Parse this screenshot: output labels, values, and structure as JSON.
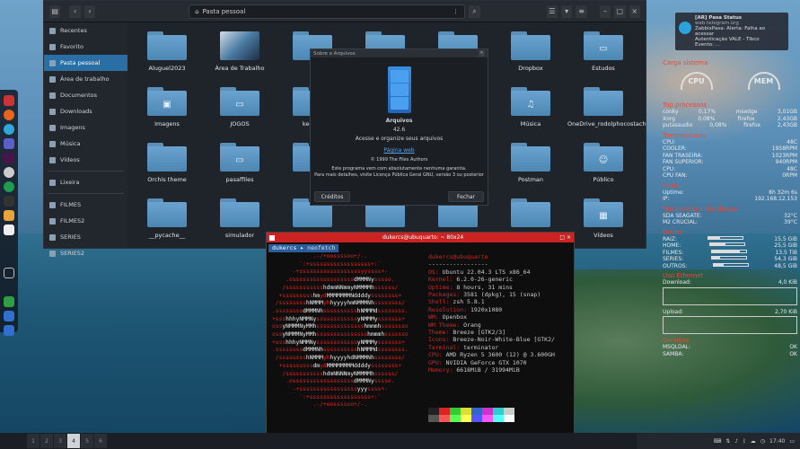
{
  "file_manager": {
    "path": "Pasta pessoal",
    "sidebar": [
      {
        "label": "Recentes",
        "active": false
      },
      {
        "label": "Favorito",
        "active": false
      },
      {
        "label": "Pasta pessoal",
        "active": true
      },
      {
        "label": "Área de trabalho",
        "active": false
      },
      {
        "label": "Documentos",
        "active": false
      },
      {
        "label": "Downloads",
        "active": false
      },
      {
        "label": "Imagens",
        "active": false
      },
      {
        "label": "Música",
        "active": false
      },
      {
        "label": "Vídeos",
        "active": false
      },
      {
        "label": "Lixeira",
        "active": false
      },
      {
        "label": "FILMES",
        "active": false
      },
      {
        "label": "FILMES2",
        "active": false
      },
      {
        "label": "SERIES",
        "active": false
      },
      {
        "label": "SERIES2",
        "active": false
      }
    ],
    "files": [
      {
        "name": "Aluguel2023",
        "kind": "folder"
      },
      {
        "name": "Área de Trabalho",
        "kind": "thumb"
      },
      {
        "name": "a",
        "kind": "folder"
      },
      {
        "name": "",
        "kind": "folder"
      },
      {
        "name": "",
        "kind": "folder"
      },
      {
        "name": "Dropbox",
        "kind": "folder"
      },
      {
        "name": "Estudos",
        "kind": "folder",
        "glyph": "▭"
      },
      {
        "name": "Imagens",
        "kind": "folder",
        "glyph": "▣"
      },
      {
        "name": "JOGOS",
        "kind": "folder",
        "glyph": "▭"
      },
      {
        "name": "keep-p",
        "kind": "folder"
      },
      {
        "name": "",
        "kind": "folder"
      },
      {
        "name": "",
        "kind": "folder"
      },
      {
        "name": "Música",
        "kind": "folder",
        "glyph": "♫"
      },
      {
        "name": "OneDrive_rodolphocostach",
        "kind": "folder"
      },
      {
        "name": "Orchis theme",
        "kind": "folder"
      },
      {
        "name": "pasaffiles",
        "kind": "folder",
        "glyph": "▭"
      },
      {
        "name": "",
        "kind": "folder"
      },
      {
        "name": "",
        "kind": "folder"
      },
      {
        "name": "",
        "kind": "folder"
      },
      {
        "name": "Postman",
        "kind": "folder"
      },
      {
        "name": "Público",
        "kind": "folder",
        "glyph": "☺"
      },
      {
        "name": "__pycache__",
        "kind": "folder"
      },
      {
        "name": "simulador",
        "kind": "folder"
      },
      {
        "name": "",
        "kind": "folder"
      },
      {
        "name": "",
        "kind": "folder"
      },
      {
        "name": "",
        "kind": "folder"
      },
      {
        "name": "",
        "kind": "folder"
      },
      {
        "name": "Vídeos",
        "kind": "folder",
        "glyph": "▦"
      }
    ]
  },
  "about": {
    "title": "Sobre o Arquivos",
    "app": "Arquivos",
    "version": "42.6",
    "desc": "Acesse e organize seus arquivos",
    "link": "Página web",
    "copyright": "© 1999 The Files Authors",
    "warranty": "Este programa vem com absolutamente nenhuma garantia.",
    "license": "Para mais detalhes, visite Licença Pública Geral GNU, versão 3 ou posterior",
    "credits": "Créditos",
    "close": "Fechar"
  },
  "terminal": {
    "title": "dukercs@ubuquarto: ~ 80x24",
    "user_prompt": "dukercs",
    "command": "neofetch",
    "header": "dukercs@ubuquarto",
    "rule": "-----------------",
    "info": [
      [
        "OS",
        "Ubuntu 22.04.3 LTS x86_64"
      ],
      [
        "Kernel",
        "6.2.0-26-generic"
      ],
      [
        "Uptime",
        "8 hours, 31 mins"
      ],
      [
        "Packages",
        "3581 (dpkg), 15 (snap)"
      ],
      [
        "Shell",
        "zsh 5.8.1"
      ],
      [
        "Resolution",
        "1920x1080"
      ],
      [
        "WM",
        "Openbox"
      ],
      [
        "WM Theme",
        "Orang"
      ],
      [
        "Theme",
        "Breeze [GTK2/3]"
      ],
      [
        "Icons",
        "Breeze-Noir-White-Blue [GTK2/"
      ],
      [
        "Terminal",
        "terminator"
      ],
      [
        "CPU",
        "AMD Ryzen 5 3600 (12) @ 3.600GH"
      ],
      [
        "GPU",
        "NVIDIA GeForce GTX 1070"
      ],
      [
        "Memory",
        "6618MiB / 31994MiB"
      ]
    ],
    "swatch_colors": [
      "#222",
      "#d22",
      "#3c3",
      "#dd3",
      "#36c",
      "#c3c",
      "#3cc",
      "#ccc",
      "#555",
      "#f55",
      "#5f5",
      "#ff5",
      "#55f",
      "#f5f",
      "#5ff",
      "#fff"
    ]
  },
  "notification": {
    "app": "[AR] Pasa Status",
    "src": "web.telegram.org",
    "l1": "ZabbixPasa: Alerta: Falha ao acessar",
    "l2": "Autenticação VALE - Tibco",
    "l3": "Evento: ..."
  },
  "conky": {
    "system_label": "Carga sistema",
    "cpu": "CPU",
    "mem": "MEM",
    "top_hdr": "Top processos",
    "top": [
      [
        "conky",
        "0,17%",
        "msedge",
        "3,01GB"
      ],
      [
        "Xorg",
        "0,08%",
        "firefox",
        "2,43GB"
      ],
      [
        "putasaudio",
        "0,08%",
        "firefox",
        "2,43GB"
      ]
    ],
    "temp_hdr": "Temperaturas",
    "temps": [
      [
        "CPU:",
        "48C"
      ],
      [
        "COOLER:",
        "1958RPM"
      ],
      [
        "FAN TRASEIRA:",
        "1023RPM"
      ],
      [
        "FAN SUPERIOR:",
        "940RPM"
      ],
      [
        "CPU:",
        "48C"
      ],
      [
        "CPU FAN:",
        "0RPM"
      ]
    ],
    "net_hdr": "Rede",
    "net": [
      [
        "Uptime:",
        "8h 32m 6s"
      ],
      [
        "IP:",
        "192.168.12.153"
      ]
    ],
    "disk_temp_hdr": "Temperatura dos discos",
    "disk_temps": [
      [
        "SDA SEAGATE:",
        "32°C"
      ],
      [
        "M2 CRUCIAL:",
        "39°C"
      ]
    ],
    "disks_hdr": "Discos",
    "disks": [
      {
        "name": "RAIZ:",
        "val": "15,5 GiB",
        "pct": 0.35
      },
      {
        "name": "HOME:",
        "val": "25,5 GiB",
        "pct": 0.45
      },
      {
        "name": "FILMES:",
        "val": "13,5 TiB",
        "pct": 0.8
      },
      {
        "name": "SERIES:",
        "val": "54,3 GiB",
        "pct": 0.25
      },
      {
        "name": "OUTROS:",
        "val": "48,5 GiB",
        "pct": 0.3
      }
    ],
    "eth_hdr": "Uso Ethernet",
    "download": "Download:",
    "download_val": "4,0 KiB",
    "upload": "Upload:",
    "upload_val": "2,70 KiB",
    "services_hdr": "Serviços",
    "services": [
      [
        "MSQLDAL:",
        "OK"
      ],
      [
        "SAMBA:",
        "OK"
      ]
    ]
  },
  "taskbar": {
    "workspaces": [
      "1",
      "2",
      "3",
      "4",
      "5",
      "6"
    ],
    "active_ws": 3,
    "clock": "17:40"
  }
}
